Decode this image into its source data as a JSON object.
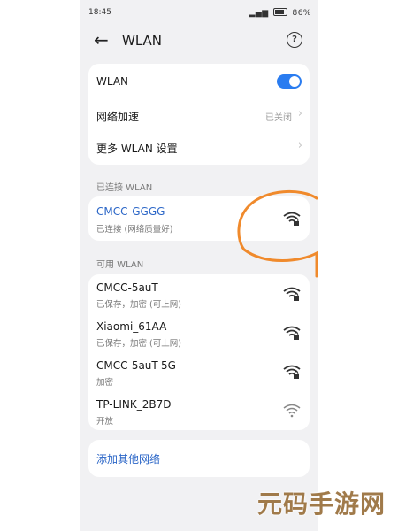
{
  "status_bar": {
    "time": "18:45",
    "battery": "86%"
  },
  "header": {
    "title": "WLAN",
    "back_icon": "arrow-left-icon",
    "help_icon": "help-circle-icon"
  },
  "settings": {
    "wlan_label": "WLAN",
    "wlan_enabled": true,
    "accel_label": "网络加速",
    "accel_value": "已关闭",
    "more_label": "更多 WLAN 设置"
  },
  "connected": {
    "section_label": "已连接 WLAN",
    "ssid": "CMCC-GGGG",
    "status": "已连接 (网络质量好)"
  },
  "available": {
    "section_label": "可用 WLAN",
    "networks": [
      {
        "ssid": "CMCC-5auT",
        "status": "已保存，加密 (可上网)",
        "locked": true
      },
      {
        "ssid": "Xiaomi_61AA",
        "status": "已保存，加密 (可上网)",
        "locked": true
      },
      {
        "ssid": "CMCC-5auT-5G",
        "status": "加密",
        "locked": true
      },
      {
        "ssid": "TP-LINK_2B7D",
        "status": "开放",
        "locked": false
      }
    ]
  },
  "add_network": {
    "label": "添加其他网络"
  },
  "colors": {
    "accent": "#2a7cf0",
    "link": "#2b66c7",
    "annotation": "#f08a2c"
  },
  "watermark": {
    "text": "元码手游网"
  }
}
